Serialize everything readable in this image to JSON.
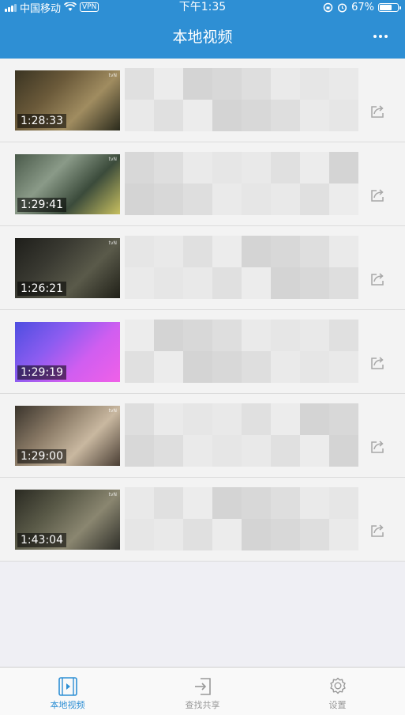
{
  "status_bar": {
    "carrier": "中国移动",
    "vpn": "VPN",
    "time": "下午1:35",
    "battery": "67%",
    "battery_level": 0.67
  },
  "nav": {
    "title": "本地视频",
    "more_icon": "ellipsis-icon"
  },
  "videos": [
    {
      "duration": "1:28:33",
      "thumb_colors": [
        "#3a3422",
        "#6b5a3a",
        "#a08c60",
        "#2a2a1c"
      ]
    },
    {
      "duration": "1:29:41",
      "thumb_colors": [
        "#4a5a4a",
        "#8a9a88",
        "#3b4b3b",
        "#c8c060"
      ]
    },
    {
      "duration": "1:26:21",
      "thumb_colors": [
        "#1e1e1a",
        "#3a3a32",
        "#5a5a4a",
        "#202018"
      ]
    },
    {
      "duration": "1:29:19",
      "thumb_colors": [
        "#4d4ee0",
        "#8b5cf0",
        "#d05ef0",
        "#f060e8"
      ]
    },
    {
      "duration": "1:29:00",
      "thumb_colors": [
        "#3a342c",
        "#8a7a66",
        "#c9b8a0",
        "#4a3e34"
      ]
    },
    {
      "duration": "1:43:04",
      "thumb_colors": [
        "#2a2a22",
        "#5a5a48",
        "#8a8670",
        "#30302a"
      ]
    }
  ],
  "tabs": [
    {
      "label": "本地视频",
      "icon": "film-icon",
      "active": true
    },
    {
      "label": "查找共享",
      "icon": "login-arrow-icon",
      "active": false
    },
    {
      "label": "设置",
      "icon": "gear-icon",
      "active": false
    }
  ],
  "colors": {
    "accent": "#2e8fd4",
    "inactive": "#999999"
  }
}
